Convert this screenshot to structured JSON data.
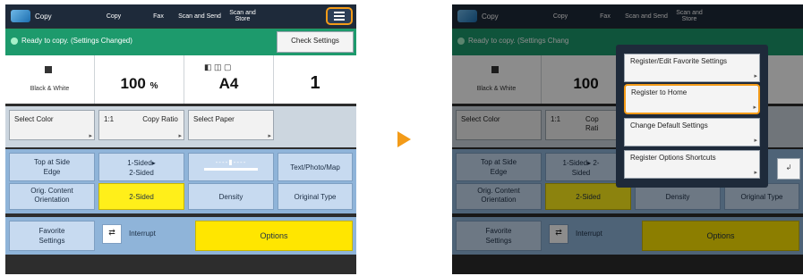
{
  "left": {
    "app_name": "Copy",
    "tabs": [
      "Copy",
      "Fax",
      "Scan and Send",
      "Scan and Store"
    ],
    "status": "Ready to copy. (Settings Changed)",
    "check_settings": "Check Settings",
    "color_mode": "Black & White",
    "ratio_value": "100",
    "ratio_unit": "%",
    "paper_icons": "◧ ◫ ▢",
    "paper_value": "A4",
    "copies": "1",
    "row_a": {
      "select_color": "Select Color",
      "ratio_label": "1:1",
      "copy_ratio": "Copy Ratio",
      "select_paper": "Select Paper"
    },
    "blue_panel": {
      "top_edge": "Top at Side Edge",
      "sided_1": "1-Sided▸",
      "sided_2": "2-Sided",
      "density_scale": "‑‑‑‑▮‑‑‑‑",
      "text_photo_map": "Text/Photo/Map",
      "orig_content": "Orig. Content Orientation",
      "two_sided": "2-Sided",
      "density": "Density",
      "original_type": "Original Type"
    },
    "bottom": {
      "favorite": "Favorite Settings",
      "interrupt_icon": "⇄",
      "interrupt": "Interrupt",
      "options": "Options"
    }
  },
  "right": {
    "app_name": "Copy",
    "tabs": [
      "Copy",
      "Fax",
      "Scan and Send",
      "Scan and Store"
    ],
    "status": "Ready to copy. (Settings Chang",
    "color_mode": "Black & White",
    "ratio_value": "100",
    "row_a": {
      "select_color": "Select Color",
      "ratio_label": "1:1",
      "copy_ratio": "Cop Rati"
    },
    "blue_panel": {
      "top_edge": "Top at Side Edge",
      "sided": "1-Sided▸ 2-Sided",
      "orig_content": "Orig. Content Orientation",
      "two_sided": "2-Sided",
      "density": "Density",
      "original_type": "Original Type"
    },
    "bottom": {
      "favorite": "Favorite Settings",
      "interrupt_icon": "⇄",
      "interrupt": "Interrupt",
      "options": "Options"
    },
    "popup": {
      "items": [
        "Register/Edit Favorite Settings",
        "Register to Home",
        "Change Default Settings",
        "Register Options Shortcuts"
      ],
      "close": "↲"
    }
  },
  "accent_color": "#f39b18"
}
